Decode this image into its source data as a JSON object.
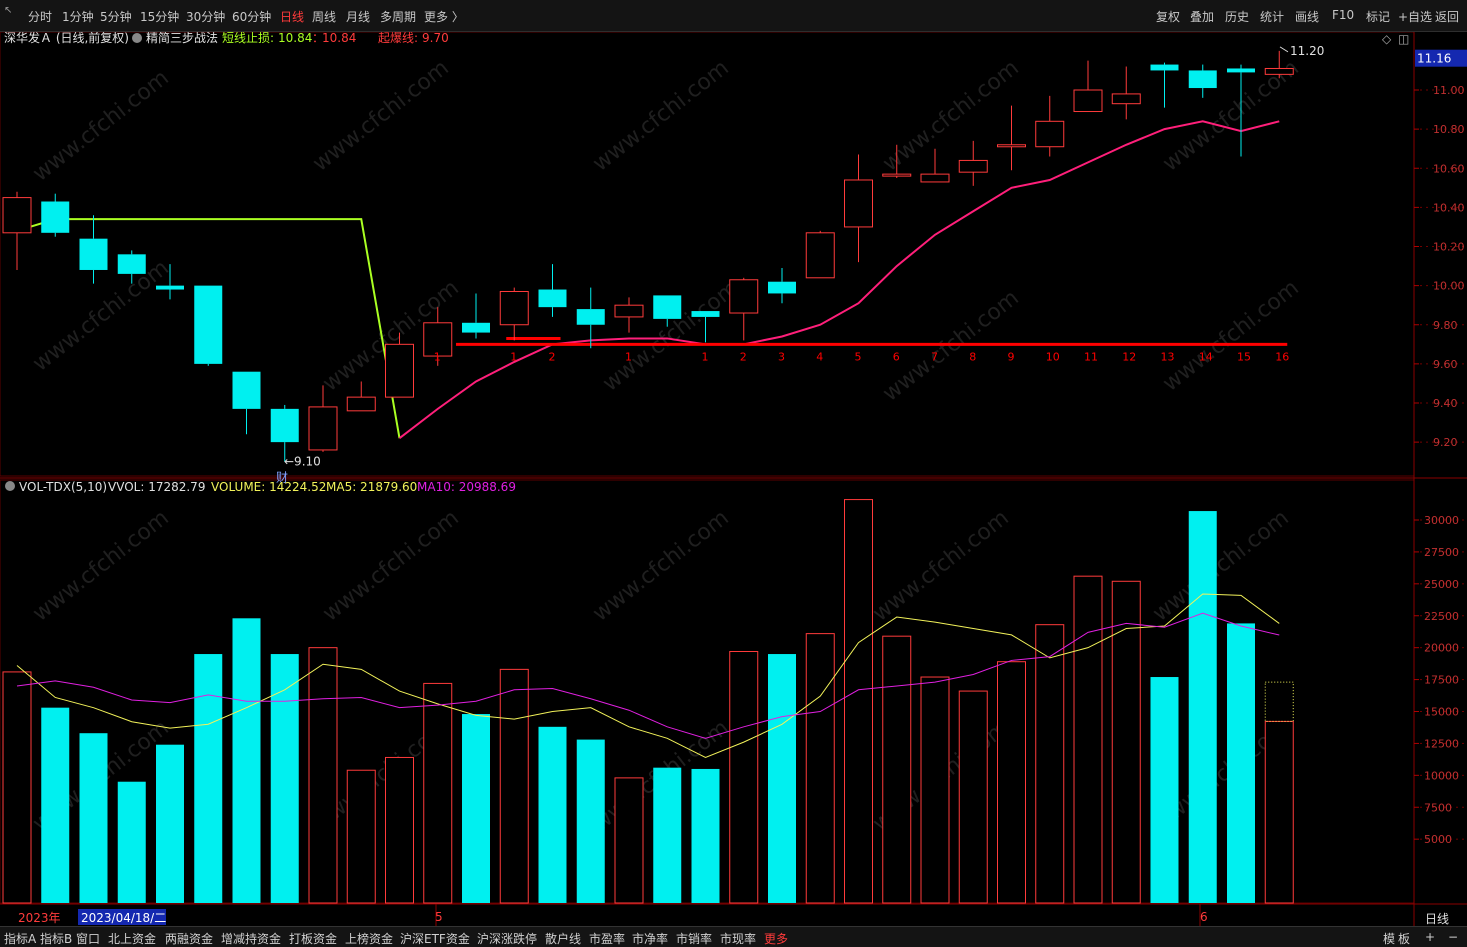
{
  "toolbar": {
    "periods": [
      {
        "label": "分时"
      },
      {
        "label": "1分钟"
      },
      {
        "label": "5分钟"
      },
      {
        "label": "15分钟"
      },
      {
        "label": "30分钟"
      },
      {
        "label": "60分钟"
      },
      {
        "label": "日线",
        "active": true
      },
      {
        "label": "周线"
      },
      {
        "label": "月线"
      },
      {
        "label": "多周期"
      },
      {
        "label": "更多 〉"
      }
    ],
    "right": [
      {
        "label": "复权"
      },
      {
        "label": "叠加"
      },
      {
        "label": "历史"
      },
      {
        "label": "统计"
      },
      {
        "label": "画线"
      },
      {
        "label": "F10"
      },
      {
        "label": "标记"
      },
      {
        "label": "+自选"
      },
      {
        "label": "返回"
      }
    ]
  },
  "main_header": {
    "stock": "深华发Ａ",
    "mode": "(日线,前复权)",
    "indicator": "精简三步战法",
    "stop_label": "短线止损:",
    "stop_v1": "10.84",
    "stop_sep": "：",
    "stop_v2": "10.84",
    "rise_label": "起爆线:",
    "rise_value": "9.70"
  },
  "vol_header": {
    "name": "VOL-TDX(5,10)",
    "vvol": "VVOL: 17282.79",
    "volume": "VOLUME: 14224.52",
    "ma5": "MA5: 21879.60",
    "ma10": "MA10: 20988.69"
  },
  "annotations": {
    "high_label": "11.20",
    "low_label": "9.10",
    "fin_marker": "财",
    "current_price": "11.16"
  },
  "date_bar": {
    "year": "2023年",
    "date": "2023/04/18/二",
    "m5": "5",
    "m6": "6",
    "period": "日线"
  },
  "bottom_tabs": [
    "指标A",
    "指标B",
    "窗口",
    "北上资金",
    "两融资金",
    "增减持资金",
    "打板资金",
    "上榜资金",
    "沪深ETF资金",
    "沪深涨跌停",
    "散户线",
    "市盈率",
    "市净率",
    "市销率",
    "市现率",
    "更多"
  ],
  "bottom_right": [
    "模",
    "板",
    "+",
    "−"
  ],
  "watermark": "www.cfchi.com",
  "colors": {
    "up": "#ff3b3b",
    "down": "#00f0f0",
    "stop_line": "#aaff22",
    "ma_line": "#ff1f7a",
    "ma5": "#f2f25a",
    "ma10": "#e020e0",
    "rise_line": "#ff0000"
  },
  "chart_data": [
    {
      "type": "candlestick",
      "title": "深华发Ａ 日线 前复权",
      "y_ticks": [
        9.2,
        9.4,
        9.6,
        9.8,
        10.0,
        10.2,
        10.4,
        10.6,
        10.8,
        11.0
      ],
      "ylim": [
        9.05,
        11.28
      ],
      "candles": [
        {
          "o": 10.27,
          "h": 10.48,
          "l": 10.08,
          "c": 10.45
        },
        {
          "o": 10.43,
          "h": 10.47,
          "l": 10.25,
          "c": 10.27
        },
        {
          "o": 10.24,
          "h": 10.36,
          "l": 10.01,
          "c": 10.08
        },
        {
          "o": 10.16,
          "h": 10.18,
          "l": 10.01,
          "c": 10.06
        },
        {
          "o": 10.0,
          "h": 10.11,
          "l": 9.93,
          "c": 9.98
        },
        {
          "o": 10.0,
          "h": 10.0,
          "l": 9.59,
          "c": 9.6
        },
        {
          "o": 9.56,
          "h": 9.56,
          "l": 9.24,
          "c": 9.37
        },
        {
          "o": 9.37,
          "h": 9.39,
          "l": 9.1,
          "c": 9.2
        },
        {
          "o": 9.16,
          "h": 9.49,
          "l": 9.15,
          "c": 9.38
        },
        {
          "o": 9.36,
          "h": 9.51,
          "l": 9.36,
          "c": 9.43
        },
        {
          "o": 9.43,
          "h": 9.76,
          "l": 9.43,
          "c": 9.7
        },
        {
          "o": 9.64,
          "h": 9.89,
          "l": 9.59,
          "c": 9.81
        },
        {
          "o": 9.81,
          "h": 9.96,
          "l": 9.73,
          "c": 9.76
        },
        {
          "o": 9.8,
          "h": 9.99,
          "l": 9.72,
          "c": 9.97
        },
        {
          "o": 9.98,
          "h": 10.11,
          "l": 9.84,
          "c": 9.89
        },
        {
          "o": 9.88,
          "h": 9.99,
          "l": 9.68,
          "c": 9.8
        },
        {
          "o": 9.84,
          "h": 9.94,
          "l": 9.76,
          "c": 9.9
        },
        {
          "o": 9.95,
          "h": 9.95,
          "l": 9.79,
          "c": 9.83
        },
        {
          "o": 9.87,
          "h": 9.87,
          "l": 9.71,
          "c": 9.84
        },
        {
          "o": 9.86,
          "h": 10.04,
          "l": 9.72,
          "c": 10.03
        },
        {
          "o": 10.02,
          "h": 10.09,
          "l": 9.91,
          "c": 9.96
        },
        {
          "o": 10.04,
          "h": 10.28,
          "l": 10.04,
          "c": 10.27
        },
        {
          "o": 10.3,
          "h": 10.67,
          "l": 10.12,
          "c": 10.54
        },
        {
          "o": 10.56,
          "h": 10.72,
          "l": 10.55,
          "c": 10.57
        },
        {
          "o": 10.53,
          "h": 10.7,
          "l": 10.53,
          "c": 10.57
        },
        {
          "o": 10.58,
          "h": 10.74,
          "l": 10.51,
          "c": 10.64
        },
        {
          "o": 10.72,
          "h": 10.92,
          "l": 10.59,
          "c": 10.72
        },
        {
          "o": 10.71,
          "h": 10.97,
          "l": 10.66,
          "c": 10.84
        },
        {
          "o": 10.89,
          "h": 11.15,
          "l": 10.89,
          "c": 11.0
        },
        {
          "o": 10.93,
          "h": 11.12,
          "l": 10.85,
          "c": 10.98
        },
        {
          "o": 11.13,
          "h": 11.14,
          "l": 10.91,
          "c": 11.1
        },
        {
          "o": 11.1,
          "h": 11.13,
          "l": 10.96,
          "c": 11.01
        },
        {
          "o": 11.11,
          "h": 11.13,
          "l": 10.66,
          "c": 11.09
        },
        {
          "o": 11.08,
          "h": 11.2,
          "l": 11.06,
          "c": 11.11
        }
      ],
      "ma_line": [
        10.28,
        10.34,
        10.34,
        10.34,
        10.34,
        10.34,
        10.34,
        10.34,
        10.34,
        10.34,
        9.22,
        9.37,
        9.51,
        9.61,
        9.7,
        9.72,
        9.73,
        9.73,
        9.7,
        9.7,
        9.74,
        9.8,
        9.91,
        10.1,
        10.26,
        10.38,
        10.5,
        10.54,
        10.63,
        10.72,
        10.8,
        10.84,
        10.79,
        10.84
      ],
      "stop_line_segment": {
        "from_index": 0,
        "to_index": 10
      },
      "rise_line": {
        "value": 9.7,
        "from_index": 12,
        "to_index": 33
      },
      "rise_short": {
        "value": 9.73,
        "from_index": 13,
        "to_index": 14
      },
      "counters": [
        {
          "index": 11,
          "label": "1"
        },
        {
          "index": 13,
          "label": "1"
        },
        {
          "index": 14,
          "label": "2"
        },
        {
          "index": 16,
          "label": "1"
        },
        {
          "index": 18,
          "label": "1"
        },
        {
          "index": 19,
          "label": "2"
        },
        {
          "index": 20,
          "label": "3"
        },
        {
          "index": 21,
          "label": "4"
        },
        {
          "index": 22,
          "label": "5"
        },
        {
          "index": 23,
          "label": "6"
        },
        {
          "index": 24,
          "label": "7"
        },
        {
          "index": 25,
          "label": "8"
        },
        {
          "index": 26,
          "label": "9"
        },
        {
          "index": 27,
          "label": "10"
        },
        {
          "index": 28,
          "label": "11"
        },
        {
          "index": 29,
          "label": "12"
        },
        {
          "index": 30,
          "label": "13"
        },
        {
          "index": 31,
          "label": "14"
        },
        {
          "index": 32,
          "label": "15"
        },
        {
          "index": 33,
          "label": "16"
        }
      ]
    },
    {
      "type": "bar",
      "title": "VOL-TDX(5,10)",
      "y_ticks": [
        5000,
        7500,
        10000,
        12500,
        15000,
        17500,
        20000,
        22500,
        25000,
        27500,
        30000
      ],
      "ylim": [
        0,
        31800
      ],
      "volumes": [
        18100,
        15300,
        13300,
        9500,
        12400,
        19500,
        22300,
        19500,
        20000,
        10400,
        11400,
        17200,
        14800,
        18300,
        13800,
        12800,
        9800,
        10600,
        10500,
        19700,
        19500,
        21100,
        31600,
        20900,
        17700,
        16600,
        18900,
        21800,
        25600,
        25200,
        17700,
        30700,
        21900,
        14224
      ],
      "vol_last_dotted": 17300,
      "ma5": [
        18600,
        16100,
        15300,
        14200,
        13700,
        14000,
        15300,
        16700,
        18700,
        18300,
        16600,
        15600,
        14700,
        14400,
        15000,
        15300,
        13800,
        12900,
        11400,
        12600,
        14000,
        16200,
        20400,
        22400,
        22000,
        21500,
        21000,
        19200,
        20000,
        21500,
        21700,
        24200,
        24100,
        21900
      ],
      "ma10": [
        17000,
        17400,
        16900,
        15900,
        15700,
        16300,
        15800,
        15800,
        16000,
        16100,
        15300,
        15500,
        15800,
        16700,
        16800,
        16000,
        15100,
        13800,
        12900,
        13800,
        14600,
        15000,
        16700,
        17000,
        17300,
        17900,
        19000,
        19300,
        21200,
        21900,
        21600,
        22700,
        21700,
        20989
      ]
    }
  ]
}
